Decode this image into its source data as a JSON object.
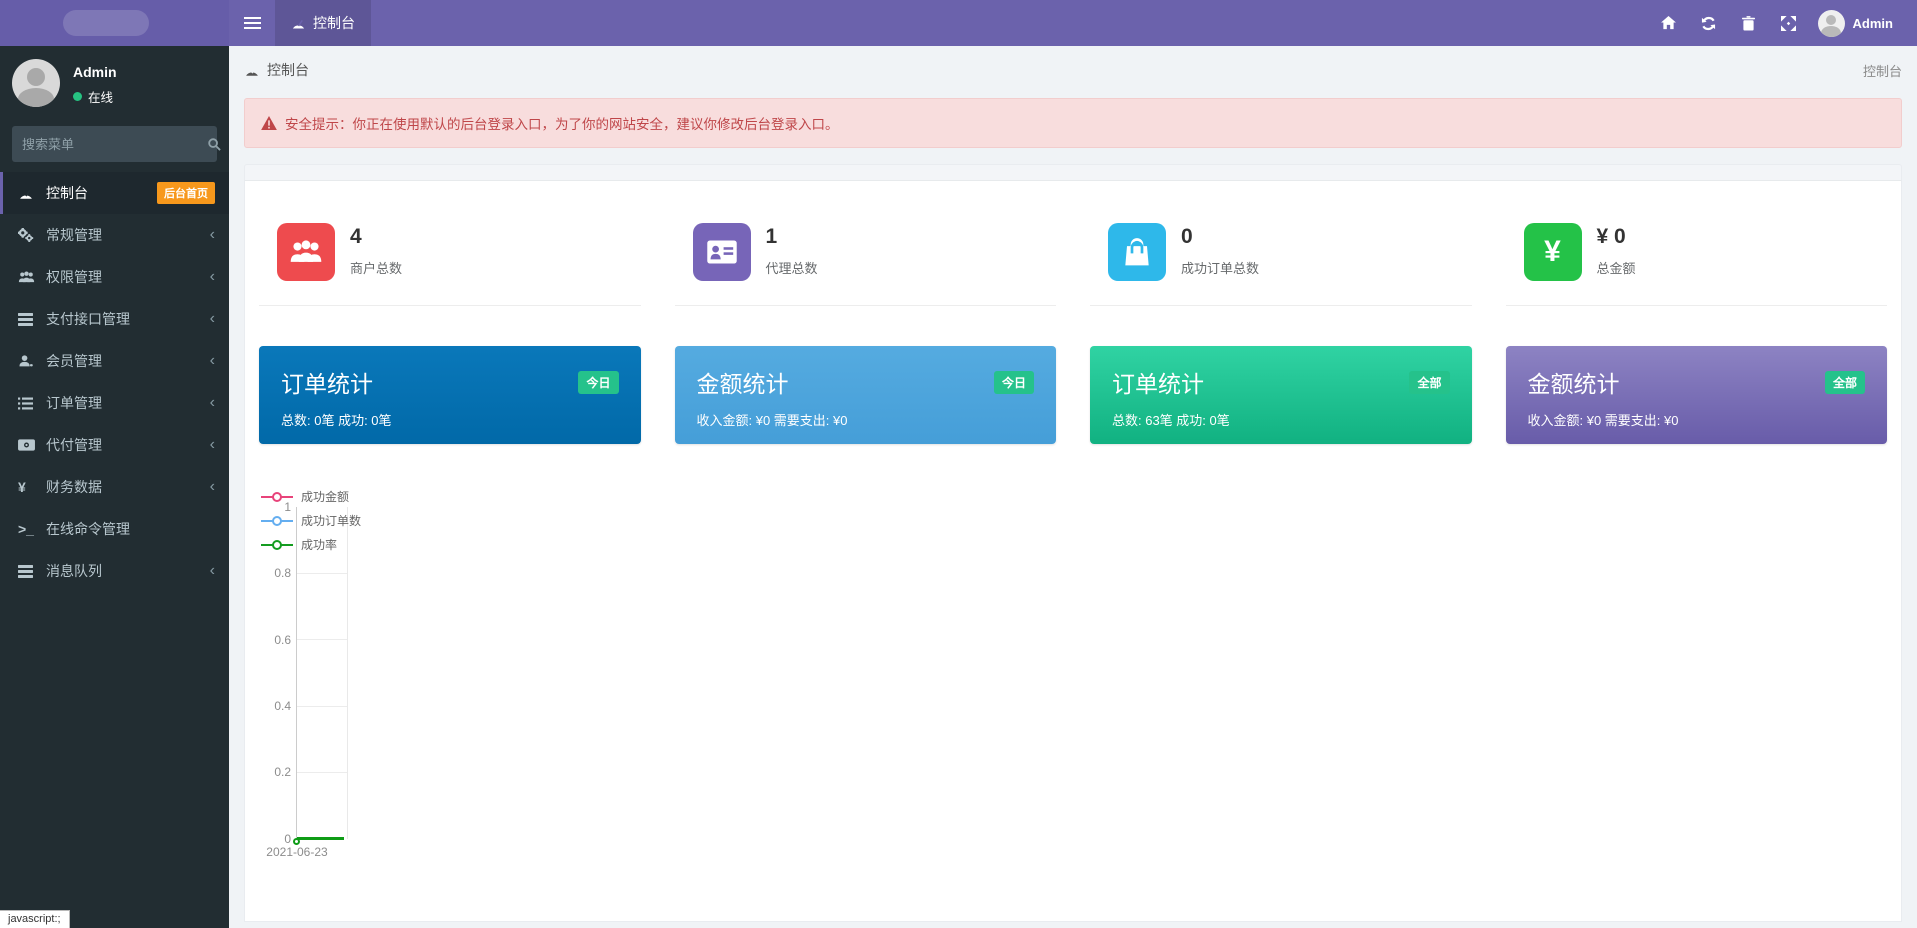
{
  "navbar": {
    "tab_label": "控制台",
    "user_name": "Admin",
    "accent_color": "#6b62ac",
    "right_icons": [
      "home-icon",
      "refresh-icon",
      "trash-icon",
      "fullscreen-icon"
    ]
  },
  "sidebar": {
    "user": {
      "name": "Admin",
      "status": "在线",
      "status_color": "#26c281"
    },
    "search_placeholder": "搜索菜单",
    "menu": [
      {
        "label": "控制台",
        "icon": "gauge-icon",
        "badge": "后台首页",
        "active": true
      },
      {
        "label": "常规管理",
        "icon": "cogs-icon",
        "expandable": true
      },
      {
        "label": "权限管理",
        "icon": "users-icon",
        "expandable": true
      },
      {
        "label": "支付接口管理",
        "icon": "bars-icon",
        "expandable": true
      },
      {
        "label": "会员管理",
        "icon": "user-icon",
        "expandable": true
      },
      {
        "label": "订单管理",
        "icon": "list-icon",
        "expandable": true
      },
      {
        "label": "代付管理",
        "icon": "money-icon",
        "expandable": true
      },
      {
        "label": "财务数据",
        "icon": "yen-icon",
        "expandable": true
      },
      {
        "label": "在线命令管理",
        "icon": "terminal-icon",
        "expandable": false
      },
      {
        "label": "消息队列",
        "icon": "bars-icon",
        "expandable": true
      }
    ],
    "badge_color": "#f7981c"
  },
  "breadcrumb": {
    "left": "控制台",
    "right": "控制台"
  },
  "alert": {
    "text": "安全提示：你正在使用默认的后台登录入口，为了你的网站安全，建议你修改后台登录入口。",
    "text_color": "#bf4649",
    "bg_color": "#f8dddd"
  },
  "stats": [
    {
      "value": "4",
      "label": "商户总数",
      "icon": "users-icon",
      "color": "#ee4b4e"
    },
    {
      "value": "1",
      "label": "代理总数",
      "icon": "id-card-icon",
      "color": "#7765b8"
    },
    {
      "value": "0",
      "label": "成功订单总数",
      "icon": "shopping-bag-icon",
      "color": "#2eb8ea"
    },
    {
      "value": "¥ 0",
      "label": "总金额",
      "icon": "yen-icon",
      "color": "#24c248"
    }
  ],
  "summary_cards": [
    {
      "title": "订单统计",
      "badge": "今日",
      "subtitle": "总数: 0笔 成功: 0笔",
      "color": "#0272b6"
    },
    {
      "title": "金额统计",
      "badge": "今日",
      "subtitle": "收入金额: ¥0 需要支出: ¥0",
      "color": "#4aa2dc"
    },
    {
      "title": "订单统计",
      "badge": "全部",
      "subtitle": "总数: 63笔 成功: 0笔",
      "color": "#1db688"
    },
    {
      "title": "金额统计",
      "badge": "全部",
      "subtitle": "收入金额: ¥0 需要支出: ¥0",
      "color": "#7b6fba"
    }
  ],
  "chart_data": {
    "type": "line",
    "x": [
      "2021-06-23"
    ],
    "series": [
      {
        "name": "成功金额",
        "color": "#e8437a",
        "values": [
          0
        ]
      },
      {
        "name": "成功订单数",
        "color": "#64aef0",
        "values": [
          0
        ]
      },
      {
        "name": "成功率",
        "color": "#0e9c16",
        "values": [
          0
        ]
      }
    ],
    "ylim": [
      0,
      1
    ],
    "yticks": [
      1,
      0.8,
      0.6,
      0.4,
      0.2,
      0
    ],
    "ytick_labels": [
      "1",
      "0.8",
      "0.6",
      "0.4",
      "0.2",
      "0"
    ],
    "legend_position": "top-left",
    "grid": true
  },
  "statusbar": {
    "text": "javascript:;"
  }
}
